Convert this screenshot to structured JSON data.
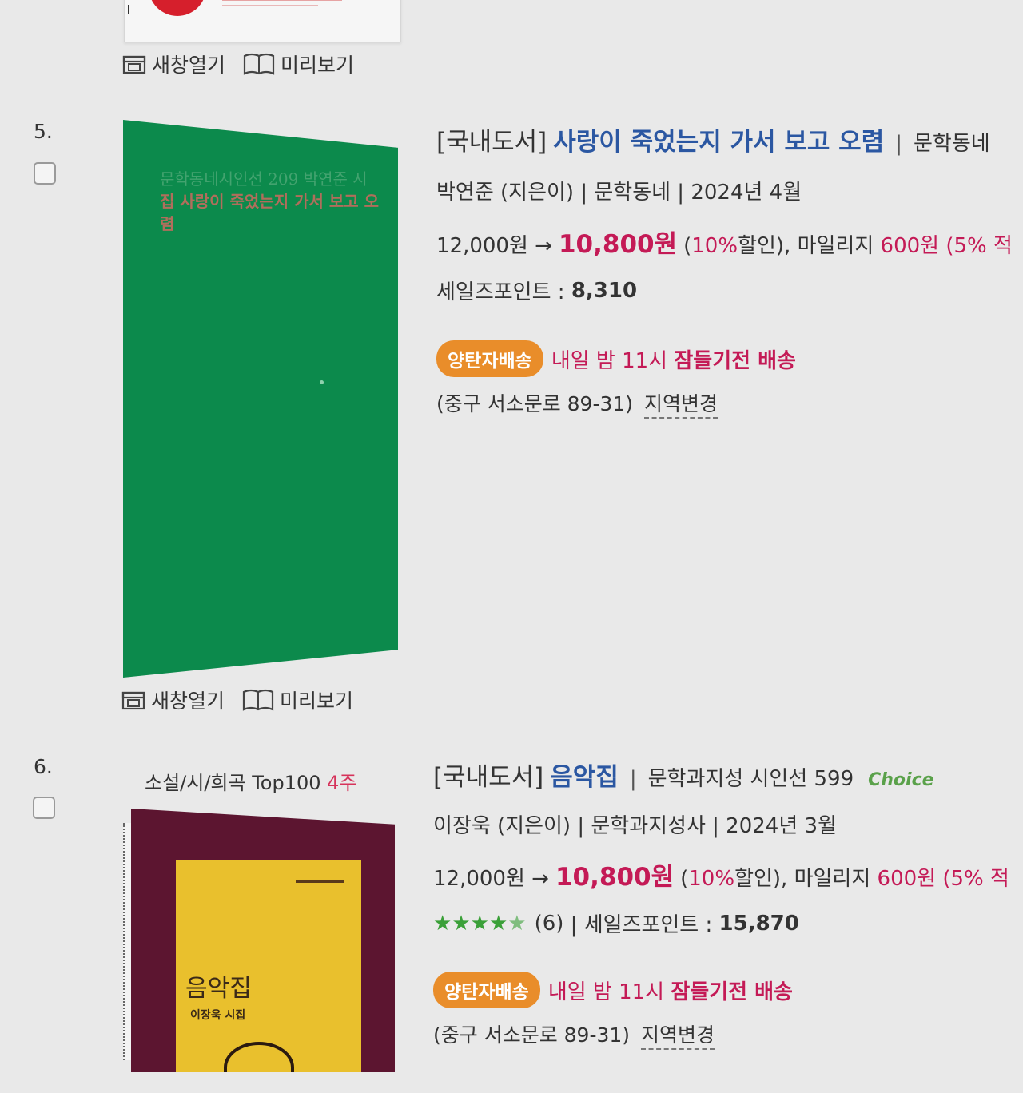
{
  "actions": {
    "new_window": "새창열기",
    "preview": "미리보기"
  },
  "items": [
    {
      "number": "5.",
      "cover_text_faint": "문학동네시인선 209 박연준 시",
      "cover_text_bold": "집 사랑이 죽었는지 가서 보고 오렴",
      "category": "[국내도서]",
      "title": "사랑이 죽었는지 가서 보고 오렴",
      "separator": "|",
      "series": "문학동네",
      "byline": "박연준 (지은이) | 문학동네 | 2024년 4월",
      "list_price": "12,000원 →",
      "sale_price": "10,800원",
      "discount_open": "(",
      "discount_rate": "10%",
      "discount_close": "할인), 마일리지",
      "mileage": "600원",
      "mileage_rate": "(5% 적",
      "points_label": "세일즈포인트 :",
      "points_value": "8,310",
      "delivery_badge": "양탄자배송",
      "delivery_text": "내일 밤 11시",
      "delivery_bold": "잠들기전 배송",
      "address": "(중구 서소문로 89-31)",
      "region_change": "지역변경"
    },
    {
      "number": "6.",
      "rank_label": "소설/시/희곡 Top100",
      "rank_weeks": "4주",
      "cover_title": "음악집",
      "cover_author": "이장욱 시집",
      "category": "[국내도서]",
      "title": "음악집",
      "separator": "|",
      "series": "문학과지성 시인선 599",
      "choice": "Choice",
      "byline": "이장욱 (지은이) | 문학과지성사 | 2024년 3월",
      "list_price": "12,000원 →",
      "sale_price": "10,800원",
      "discount_open": "(",
      "discount_rate": "10%",
      "discount_close": "할인), 마일리지",
      "mileage": "600원",
      "mileage_rate": "(5% 적",
      "rating_stars": 4.5,
      "review_count": "(6)",
      "points_label": "| 세일즈포인트 :",
      "points_value": "15,870",
      "delivery_badge": "양탄자배송",
      "delivery_text": "내일 밤 11시",
      "delivery_bold": "잠들기전 배송",
      "address": "(중구 서소문로 89-31)",
      "region_change": "지역변경"
    }
  ],
  "colors": {
    "title_blue": "#2b57a2",
    "price_red": "#c41a56",
    "badge_orange": "#e98d2a",
    "cover5_green": "#0c8a4c",
    "cover6_maroon": "#5c1530",
    "cover6_yellow": "#e9c02d"
  }
}
